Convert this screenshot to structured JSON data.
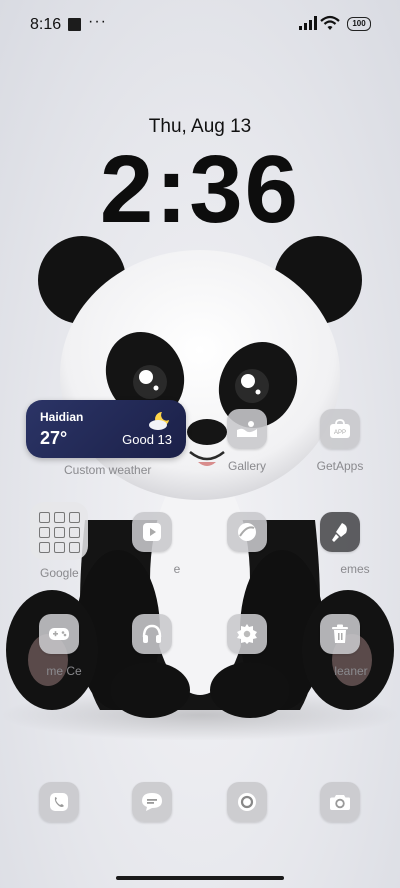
{
  "status_bar": {
    "time": "8:16",
    "overflow": "···",
    "battery": "100",
    "icons": [
      "notification-square-icon",
      "signal-icon",
      "wifi-icon",
      "battery-icon"
    ]
  },
  "lockscreen": {
    "date": "Thu, Aug 13",
    "clock": "2:36"
  },
  "weather_widget": {
    "city": "Haidian",
    "temperature": "27°",
    "air_quality": "Good 13",
    "label": "Custom weather",
    "icon": "partly-cloudy-night-icon"
  },
  "apps": {
    "gallery": "Gallery",
    "getapps": "GetApps",
    "google_folder": "Google",
    "video_partial": "e",
    "themes_partial": "emes",
    "game_partial": "me Ce",
    "cleaner_partial": "leaner"
  },
  "colors": {
    "widget_bg": "#1f2550",
    "icon_bg": "#c8c8cc",
    "label": "#8a8a8e"
  }
}
